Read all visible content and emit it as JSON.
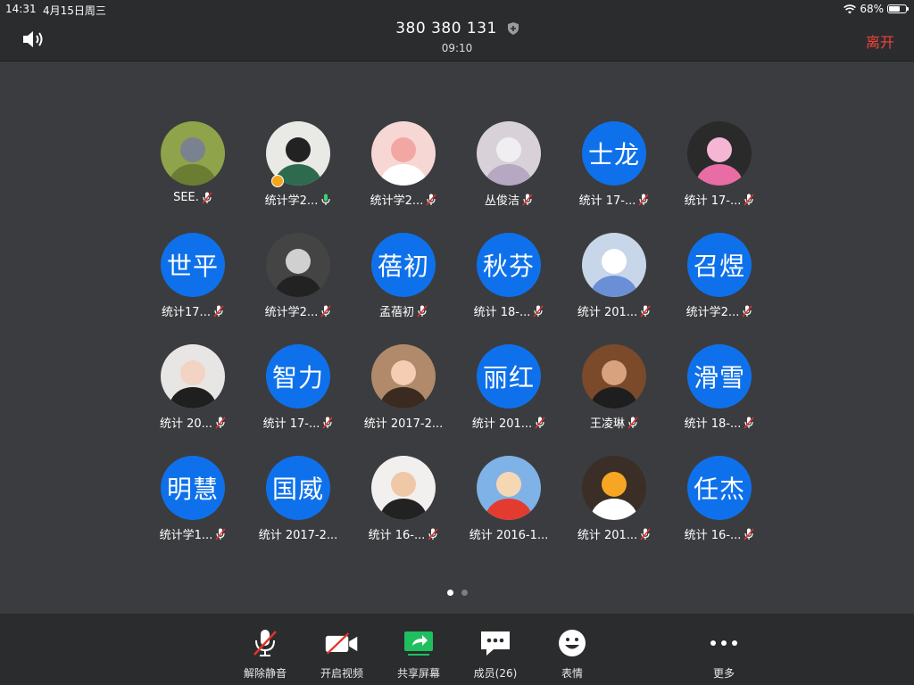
{
  "status_bar": {
    "time": "14:31",
    "date": "4月15日周三",
    "battery": "68%",
    "battery_level": 0.68
  },
  "header": {
    "meeting_id": "380 380 131",
    "duration": "09:10",
    "leave_label": "离开"
  },
  "participants": [
    {
      "name": "SEE.",
      "avatar_text": "",
      "avatar_icon": "cat-mouse-photo",
      "mic": "muted"
    },
    {
      "name": "统计学2...",
      "avatar_text": "",
      "avatar_icon": "girl-illustration",
      "mic": "on",
      "host": true
    },
    {
      "name": "统计学2...",
      "avatar_text": "",
      "avatar_icon": "bunny-cartoon",
      "mic": "muted"
    },
    {
      "name": "丛俊洁",
      "avatar_text": "",
      "avatar_icon": "plush-toy-photo",
      "mic": "muted"
    },
    {
      "name": "统计 17-...",
      "avatar_text": "士龙",
      "mic": "muted"
    },
    {
      "name": "统计 17-...",
      "avatar_text": "",
      "avatar_icon": "pink-shell-photo",
      "mic": "muted"
    },
    {
      "name": "统计17...",
      "avatar_text": "世平",
      "mic": "muted"
    },
    {
      "name": "统计学2...",
      "avatar_text": "",
      "avatar_icon": "bw-portrait-photo",
      "mic": "muted"
    },
    {
      "name": "孟蓓初",
      "avatar_text": "蓓初",
      "mic": "muted"
    },
    {
      "name": "统计 18-...",
      "avatar_text": "秋芬",
      "mic": "muted"
    },
    {
      "name": "统计 201...",
      "avatar_text": "",
      "avatar_icon": "unicorn-cartoon",
      "mic": "muted"
    },
    {
      "name": "统计学2...",
      "avatar_text": "召煜",
      "mic": "muted"
    },
    {
      "name": "统计 20...",
      "avatar_text": "",
      "avatar_icon": "girl-portrait-photo",
      "mic": "muted"
    },
    {
      "name": "统计 17-...",
      "avatar_text": "智力",
      "mic": "muted"
    },
    {
      "name": "统计 2017-2...",
      "avatar_text": "",
      "avatar_icon": "child-photo",
      "mic": "none"
    },
    {
      "name": "统计 201...",
      "avatar_text": "丽红",
      "mic": "muted"
    },
    {
      "name": "王凌琳",
      "avatar_text": "",
      "avatar_icon": "man-photo",
      "mic": "muted"
    },
    {
      "name": "统计 18-...",
      "avatar_text": "滑雪",
      "mic": "muted"
    },
    {
      "name": "统计学1...",
      "avatar_text": "明慧",
      "mic": "muted"
    },
    {
      "name": "统计 2017-2...",
      "avatar_text": "国威",
      "mic": "none"
    },
    {
      "name": "统计 16-...",
      "avatar_text": "",
      "avatar_icon": "boy-photo",
      "mic": "muted"
    },
    {
      "name": "统计 2016-1...",
      "avatar_text": "",
      "avatar_icon": "crayon-shin-chan-cartoon",
      "mic": "none"
    },
    {
      "name": "统计 201...",
      "avatar_text": "",
      "avatar_icon": "duck-photo",
      "mic": "muted"
    },
    {
      "name": "统计 16-...",
      "avatar_text": "任杰",
      "mic": "muted"
    }
  ],
  "pager": {
    "pages": 2,
    "current": 1
  },
  "toolbar": {
    "unmute": "解除静音",
    "start_video": "开启视频",
    "share_screen": "共享屏幕",
    "participants": "成员(26)",
    "reactions": "表情",
    "more": "更多"
  },
  "colors": {
    "accent": "#0e71eb",
    "leave": "#f0443b",
    "share": "#1fbf5f",
    "mute_slash": "#e0342c"
  }
}
